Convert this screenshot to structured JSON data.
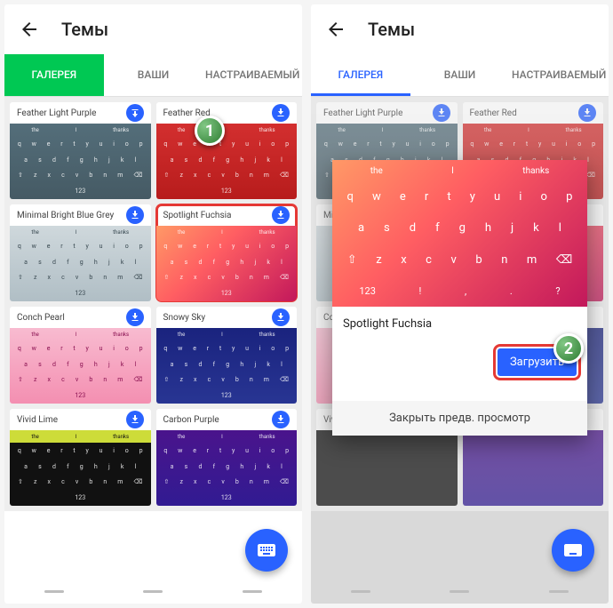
{
  "header": {
    "title": "Темы"
  },
  "tabs": {
    "gallery": "ГАЛЕРЕЯ",
    "yours": "ВАШИ",
    "custom": "НАСТРАИВАЕМЫЙ"
  },
  "themes": [
    {
      "name": "Feather Light Purple"
    },
    {
      "name": "Feather Red"
    },
    {
      "name": "Minimal Bright Blue Grey"
    },
    {
      "name": "Spotlight Fuchsia"
    },
    {
      "name": "Conch Pearl"
    },
    {
      "name": "Snowy Sky"
    },
    {
      "name": "Vivid Lime"
    },
    {
      "name": "Carbon Purple"
    }
  ],
  "kb": {
    "sug": [
      "the",
      "I",
      "thanks"
    ],
    "r1": [
      "q",
      "w",
      "e",
      "r",
      "t",
      "y",
      "u",
      "i",
      "o",
      "p"
    ],
    "r2": [
      "a",
      "s",
      "d",
      "f",
      "g",
      "h",
      "j",
      "k",
      "l"
    ],
    "r3": [
      "⇧",
      "z",
      "x",
      "c",
      "v",
      "b",
      "n",
      "m",
      "⌫"
    ],
    "r4": [
      "123",
      "!",
      ",",
      ".",
      "?"
    ]
  },
  "modal": {
    "name": "Spotlight Fuchsia",
    "load": "Загрузить",
    "close": "Закрыть предв. просмотр"
  },
  "markers": {
    "one": "1",
    "two": "2"
  }
}
